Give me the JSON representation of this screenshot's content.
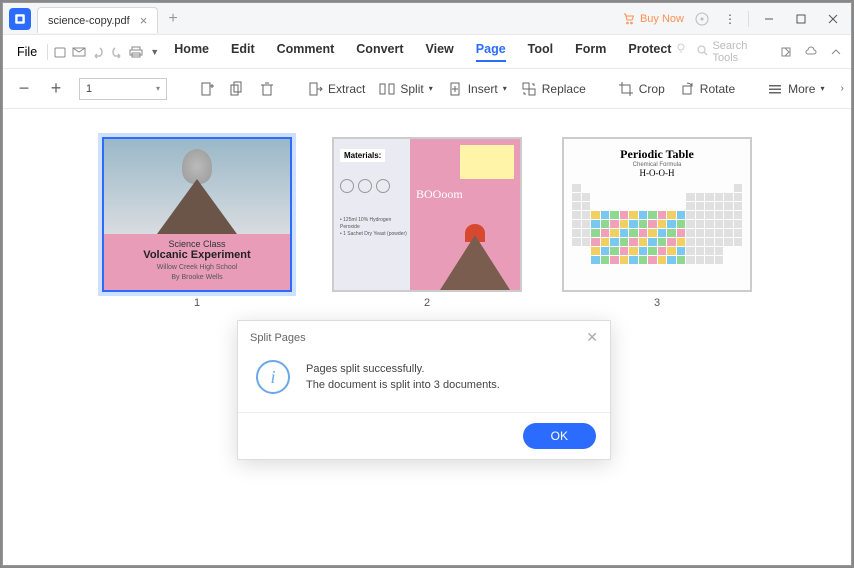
{
  "title": "science-copy.pdf",
  "buy_now": "Buy Now",
  "file_label": "File",
  "menu": {
    "home": "Home",
    "edit": "Edit",
    "comment": "Comment",
    "convert": "Convert",
    "view": "View",
    "page": "Page",
    "tool": "Tool",
    "form": "Form",
    "protect": "Protect"
  },
  "search_placeholder": "Search Tools",
  "page_input": "1",
  "tools": {
    "extract": "Extract",
    "split": "Split",
    "insert": "Insert",
    "replace": "Replace",
    "crop": "Crop",
    "rotate": "Rotate",
    "more": "More"
  },
  "thumbs": {
    "p1": {
      "label": "1",
      "line1": "Science Class",
      "line2": "Volcanic Experiment",
      "line3": "Willow Creek High School",
      "line4": "By Brooke Wells"
    },
    "p2": {
      "label": "2",
      "materials": "Materials:",
      "ing1": "• 125ml 10% Hydrogen Peroxide",
      "ing2": "• 1 Sachet Dry Yeast (powder)",
      "boom": "BOOoom"
    },
    "p3": {
      "label": "3",
      "title": "Periodic Table",
      "sub": "Chemical Formula",
      "formula": "H-O-O-H"
    }
  },
  "dialog": {
    "title": "Split Pages",
    "line1": "Pages split successfully.",
    "line2": "The document is split into 3 documents.",
    "icon_char": "i",
    "ok": "OK"
  }
}
